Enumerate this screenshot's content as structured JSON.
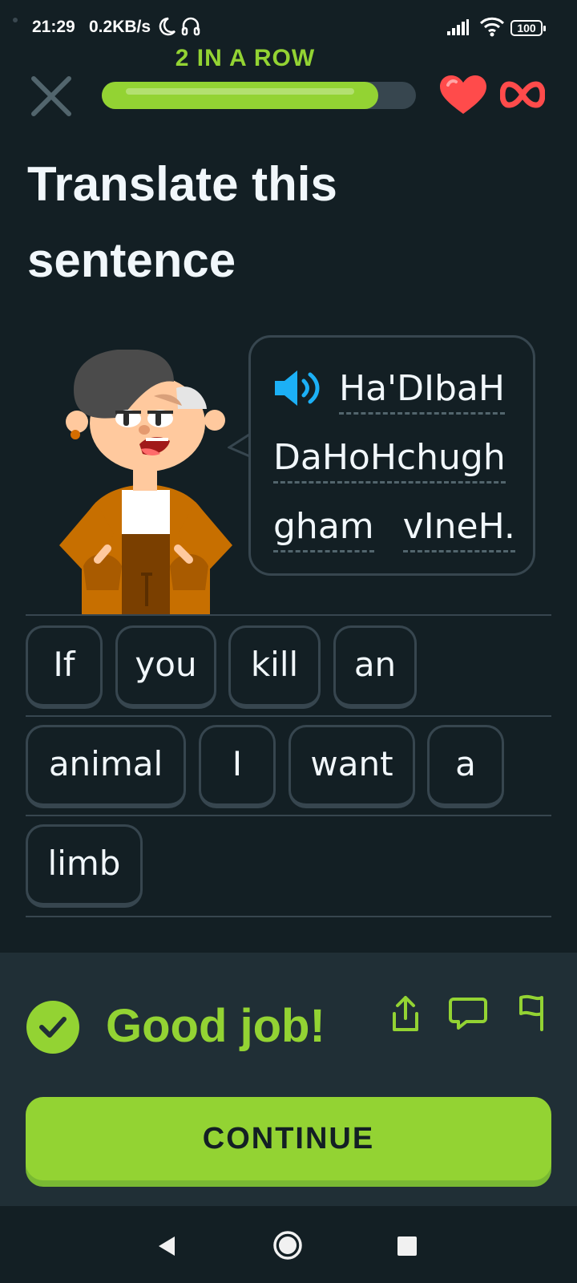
{
  "status_bar": {
    "time": "21:29",
    "network_speed": "0.2KB/s",
    "battery": "100",
    "icons": [
      "moon-icon",
      "headset-icon",
      "signal-icon",
      "wifi-icon",
      "battery-icon"
    ]
  },
  "header": {
    "streak_label": "2 IN A ROW",
    "progress": 0.88,
    "hearts": "∞",
    "accent_color": "#93d333",
    "heart_color": "#ff4b4b"
  },
  "exercise": {
    "title": "Translate this sentence",
    "prompt_lines": [
      [
        "Ha'DIbaH"
      ],
      [
        "DaHoHchugh"
      ],
      [
        "gham",
        "vIneH."
      ]
    ]
  },
  "answer": {
    "words": [
      "If",
      "you",
      "kill",
      "an",
      "animal",
      "I",
      "want",
      "a",
      "limb"
    ]
  },
  "feedback": {
    "message": "Good job!",
    "continue_label": "CONTINUE"
  }
}
